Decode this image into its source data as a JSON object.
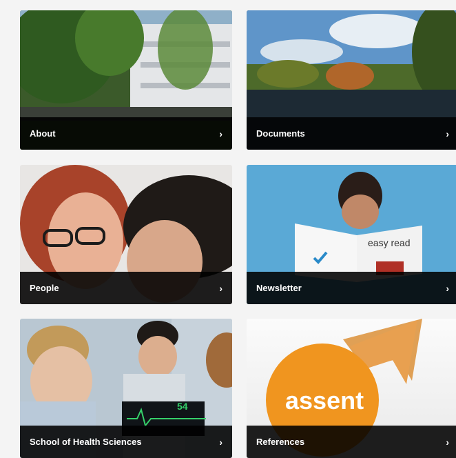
{
  "cards": [
    {
      "label": "About",
      "chevron": "›",
      "image": "building-among-trees-photo"
    },
    {
      "label": "Documents",
      "chevron": "›",
      "image": "lake-landscape-photo"
    },
    {
      "label": "People",
      "chevron": "›",
      "image": "two-women-photo"
    },
    {
      "label": "Newsletter",
      "chevron": "›",
      "image": "child-reading-easy-read-photo",
      "image_text": "easy read"
    },
    {
      "label": "School of Health Sciences",
      "chevron": "›",
      "image": "nursing-students-photo",
      "image_text": "54"
    },
    {
      "label": "References",
      "chevron": "›",
      "image": "assent-logo",
      "logo_text": "assent"
    }
  ],
  "colors": {
    "overlay": "#000000",
    "label": "#ffffff",
    "assent_orange": "#f0951f"
  }
}
